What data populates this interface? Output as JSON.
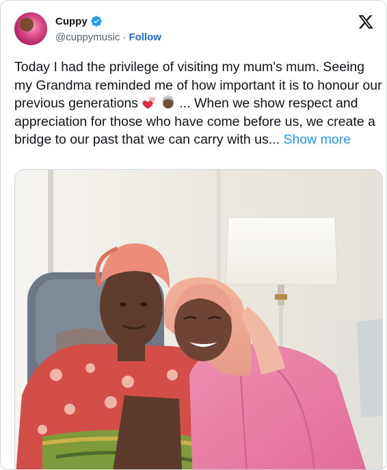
{
  "user": {
    "name": "Cuppy",
    "handle": "@cuppymusic",
    "separator": "·",
    "follow_label": "Follow"
  },
  "tweet": {
    "text_before_emoji": "Today I had the privilege of visiting my mum's mum. Seeing my Grandma reminded me of how important it is to honour our previous generations ",
    "text_after_emoji": " ... When we show respect and appreciation for those who have come before us, we create a bridge to our past that we can carry with us... ",
    "show_more_label": "Show more",
    "emojis": [
      "two-hearts-icon",
      "older-woman-icon"
    ]
  },
  "colors": {
    "link": "#1d9bf0",
    "follow": "#1d6ad4",
    "verified": "#1d9bf0",
    "text": "#0f1419",
    "muted": "#536471"
  },
  "photo": {
    "subject": "photo-grandma-and-granddaughter"
  }
}
